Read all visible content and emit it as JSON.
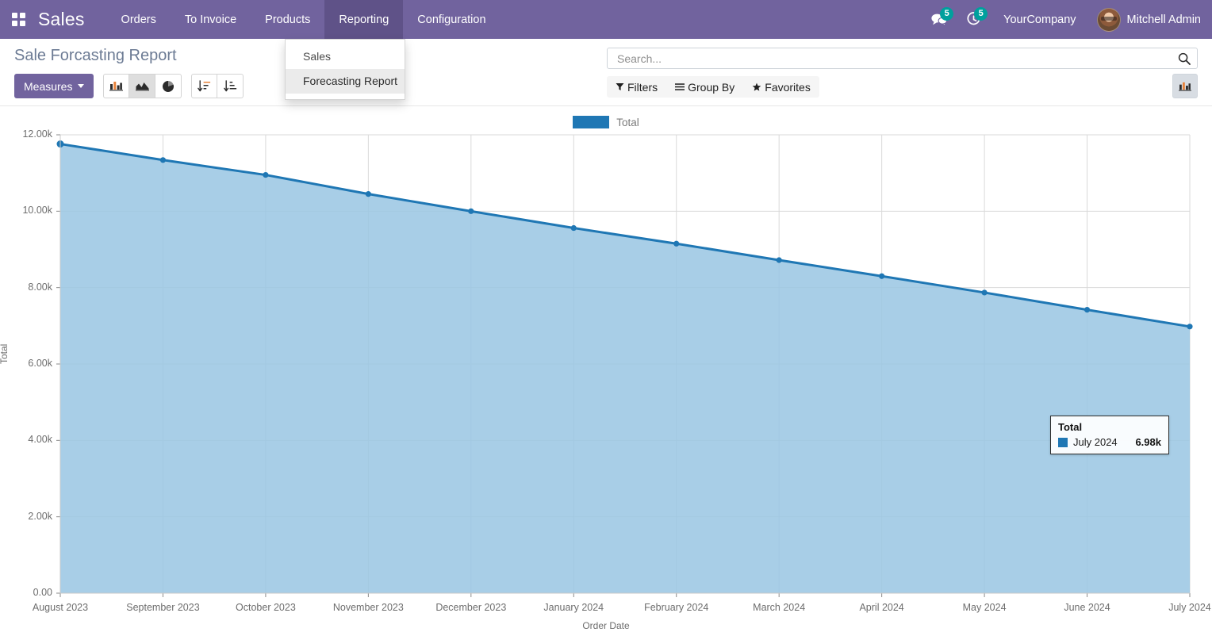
{
  "navbar": {
    "apps_icon": "apps-grid-icon",
    "brand": "Sales",
    "menu_items": [
      {
        "label": "Orders",
        "open": false
      },
      {
        "label": "To Invoice",
        "open": false
      },
      {
        "label": "Products",
        "open": false
      },
      {
        "label": "Reporting",
        "open": true
      },
      {
        "label": "Configuration",
        "open": false
      }
    ],
    "messages_icon": "chat-bubble-icon",
    "messages_count": "5",
    "activities_icon": "clock-activity-icon",
    "activities_count": "5",
    "company": "YourCompany",
    "user": "Mitchell Admin",
    "background_color": "#71639e"
  },
  "dropdown": {
    "items": [
      {
        "label": "Sales",
        "active": false
      },
      {
        "label": "Forecasting Report",
        "active": true
      }
    ]
  },
  "control_panel": {
    "title": "Sale Forcasting Report",
    "measures_label": "Measures",
    "chart_buttons": [
      {
        "icon": "bar-chart-icon",
        "active": false
      },
      {
        "icon": "area-chart-icon",
        "active": true
      },
      {
        "icon": "pie-chart-icon",
        "active": false
      }
    ],
    "sort_buttons": [
      {
        "icon": "sort-descending-icon",
        "active": false
      },
      {
        "icon": "sort-ascending-icon",
        "active": false
      }
    ],
    "view_toggle": {
      "icon": "graph-view-icon",
      "active": true
    }
  },
  "search": {
    "placeholder": "Search...",
    "value": "",
    "search_icon": "magnifier-icon"
  },
  "facets": [
    {
      "icon": "filter-icon",
      "label": "Filters"
    },
    {
      "icon": "hamburger-icon",
      "label": "Group By"
    },
    {
      "icon": "star-icon",
      "label": "Favorites"
    }
  ],
  "tooltip": {
    "title": "Total",
    "series_label": "July 2024",
    "value": "6.98k",
    "swatch_color": "#1f77b4"
  },
  "chart_data": {
    "type": "area",
    "title": "",
    "xlabel": "Order Date",
    "ylabel": "Total",
    "legend": [
      {
        "name": "Total",
        "color": "#1f77b4"
      }
    ],
    "legend_position": "top-center",
    "grid": true,
    "ylim": [
      0,
      12000
    ],
    "yticks": [
      0,
      2000,
      4000,
      6000,
      8000,
      10000,
      12000
    ],
    "ytick_labels": [
      "0.00",
      "2.00k",
      "4.00k",
      "6.00k",
      "8.00k",
      "10.00k",
      "12.00k"
    ],
    "categories": [
      "August 2023",
      "September 2023",
      "October 2023",
      "November 2023",
      "December 2023",
      "January 2024",
      "February 2024",
      "March 2024",
      "April 2024",
      "May 2024",
      "June 2024",
      "July 2024"
    ],
    "series": [
      {
        "name": "Total",
        "color": "#1f77b4",
        "fill_color": "#99c5e3",
        "values": [
          11760,
          11340,
          10950,
          10450,
          10000,
          9560,
          9150,
          8720,
          8300,
          7870,
          7420,
          6980
        ]
      }
    ]
  }
}
